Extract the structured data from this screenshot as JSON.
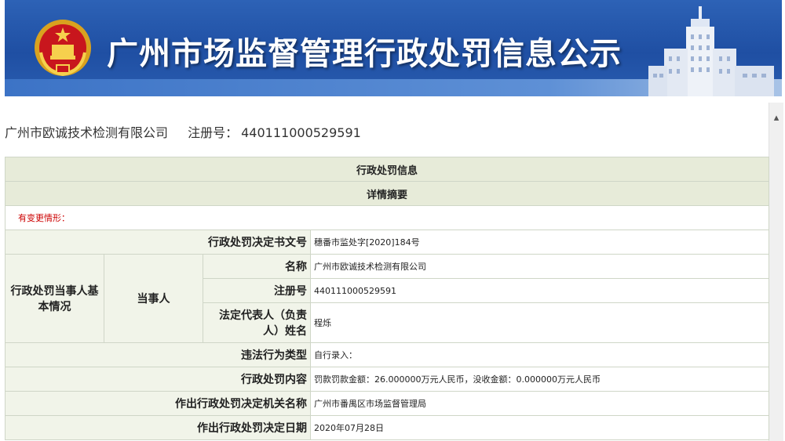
{
  "banner": {
    "title": "广州市场监督管理行政处罚信息公示"
  },
  "company": {
    "name": "广州市欧诚技术检测有限公司",
    "reg_label": "注册号：",
    "reg_no": "440111000529591"
  },
  "table": {
    "section_title": "行政处罚信息",
    "summary_title": "详情摘要",
    "change_note": "有变更情形：",
    "doc_no_label": "行政处罚决定书文号",
    "doc_no": "穗番市监处字[2020]184号",
    "party_group_label": "行政处罚当事人基本情况",
    "party_label": "当事人",
    "name_label": "名称",
    "name_value": "广州市欧诚技术检测有限公司",
    "reg_label": "注册号",
    "reg_value": "440111000529591",
    "legal_rep_label": "法定代表人（负责人）姓名",
    "legal_rep_value": "程烁",
    "violation_label": "违法行为类型",
    "violation_value": "自行录入：",
    "penalty_label": "行政处罚内容",
    "penalty_value": "罚款罚款金额：26.000000万元人民币，没收金额：0.000000万元人民币",
    "authority_label": "作出行政处罚决定机关名称",
    "authority_value": "广州市番禺区市场监督管理局",
    "date_label": "作出行政处罚决定日期",
    "date_value": "2020年07月28日"
  }
}
